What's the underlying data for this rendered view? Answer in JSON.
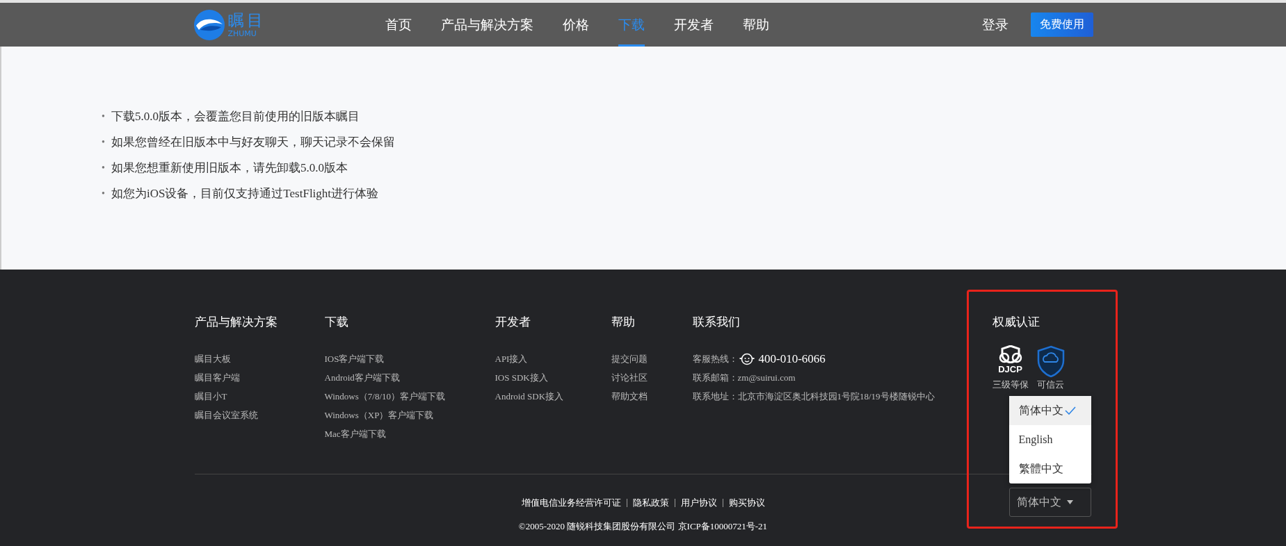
{
  "header": {
    "logo": {
      "name": "瞩目",
      "subtitle": "ZHUMU"
    },
    "nav": [
      {
        "label": "首页",
        "selected": false
      },
      {
        "label": "产品与解决方案",
        "selected": false
      },
      {
        "label": "价格",
        "selected": false
      },
      {
        "label": "下载",
        "selected": true
      },
      {
        "label": "开发者",
        "selected": false
      },
      {
        "label": "帮助",
        "selected": false
      }
    ],
    "login": "登录",
    "cta": "免费使用"
  },
  "notices": [
    {
      "marker": "•",
      "text": "下载5.0.0版本，会覆盖您目前使用的旧版本瞩目"
    },
    {
      "marker": "•",
      "text": "如果您曾经在旧版本中与好友聊天，聊天记录不会保留"
    },
    {
      "marker": "•",
      "text": "如果您想重新使用旧版本，请先卸载5.0.0版本"
    },
    {
      "marker": "•",
      "text": "如您为iOS设备，目前仅支持通过TestFlight进行体验"
    }
  ],
  "footer": {
    "columns": [
      {
        "title": "产品与解决方案",
        "items": [
          "瞩目大板",
          "瞩目客户端",
          "瞩目小T",
          "瞩目会议室系统"
        ]
      },
      {
        "title": "下载",
        "items": [
          "IOS客户端下载",
          "Android客户端下载",
          "Windows（7/8/10）客户端下载",
          "Windows（XP）客户端下载",
          "Mac客户端下载"
        ]
      },
      {
        "title": "开发者",
        "items": [
          "API接入",
          "IOS SDK接入",
          "Android SDK接入"
        ]
      },
      {
        "title": "帮助",
        "items": [
          "提交问题",
          "讨论社区",
          "帮助文档"
        ]
      }
    ],
    "contact": {
      "title": "联系我们",
      "items": [
        {
          "kind": "phone",
          "label": "客服热线：",
          "value": "400-010-6066"
        },
        {
          "kind": "text",
          "label": "联系邮箱：",
          "value": "zm@suirui.com"
        },
        {
          "kind": "text",
          "label": "联系地址：",
          "value": "北京市海淀区奥北科技园1号院18/19号楼随锐中心"
        }
      ]
    },
    "certification": {
      "title": "权威认证",
      "badges": [
        {
          "kind": "djcp",
          "logo_text": "DJCP",
          "label": "三级等保"
        },
        {
          "kind": "cloud",
          "label": "可信云"
        }
      ]
    },
    "language": {
      "current": "简体中文",
      "options": [
        {
          "label": "简体中文",
          "selected": true
        },
        {
          "label": "English",
          "selected": false
        },
        {
          "label": "繁體中文",
          "selected": false
        }
      ]
    },
    "links": [
      "增值电信业务经营许可证",
      "隐私政策",
      "用户协议",
      "购买协议"
    ],
    "copyright": "©2005-2020 随锐科技集团股份有限公司 京ICP备10000721号-21"
  }
}
